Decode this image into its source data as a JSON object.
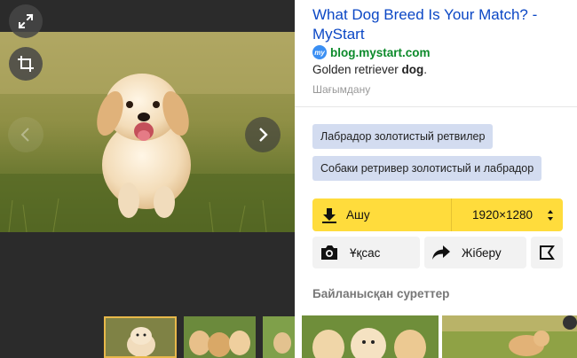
{
  "viewer": {
    "expand_icon": "expand-icon",
    "crop_icon": "crop-icon",
    "prev_icon": "chevron-left-icon",
    "next_icon": "chevron-right-icon",
    "main_image": "golden retriever puppy running on grass",
    "thumbnails": [
      {
        "name": "puppy running",
        "selected": true
      },
      {
        "name": "group of puppies",
        "selected": false
      },
      {
        "name": "puppy on grass",
        "selected": false
      }
    ]
  },
  "result": {
    "title": "What Dog Breed Is Your Match? - MyStart",
    "favicon": "my",
    "site": "blog.mystart.com",
    "snippet_prefix": "Golden retriever ",
    "snippet_bold": "dog",
    "snippet_suffix": ".",
    "complain": "Шағымдану"
  },
  "tags": [
    "Лабрадор золотистый ретвилер",
    "Собаки ретривер золотистый и лабрадор"
  ],
  "download": {
    "label": "Ашу",
    "size": "1920×1280"
  },
  "actions": {
    "similar_label": "Ұқсас",
    "share_label": "Жіберу"
  },
  "related": {
    "heading": "Байланысқан суреттер"
  },
  "colors": {
    "link": "#0b47c5",
    "site": "#0c8a2a",
    "accent_yellow": "#ffdc3c",
    "tag_bg": "#d3dcf0",
    "viewer_bg": "#2b2b2b"
  }
}
